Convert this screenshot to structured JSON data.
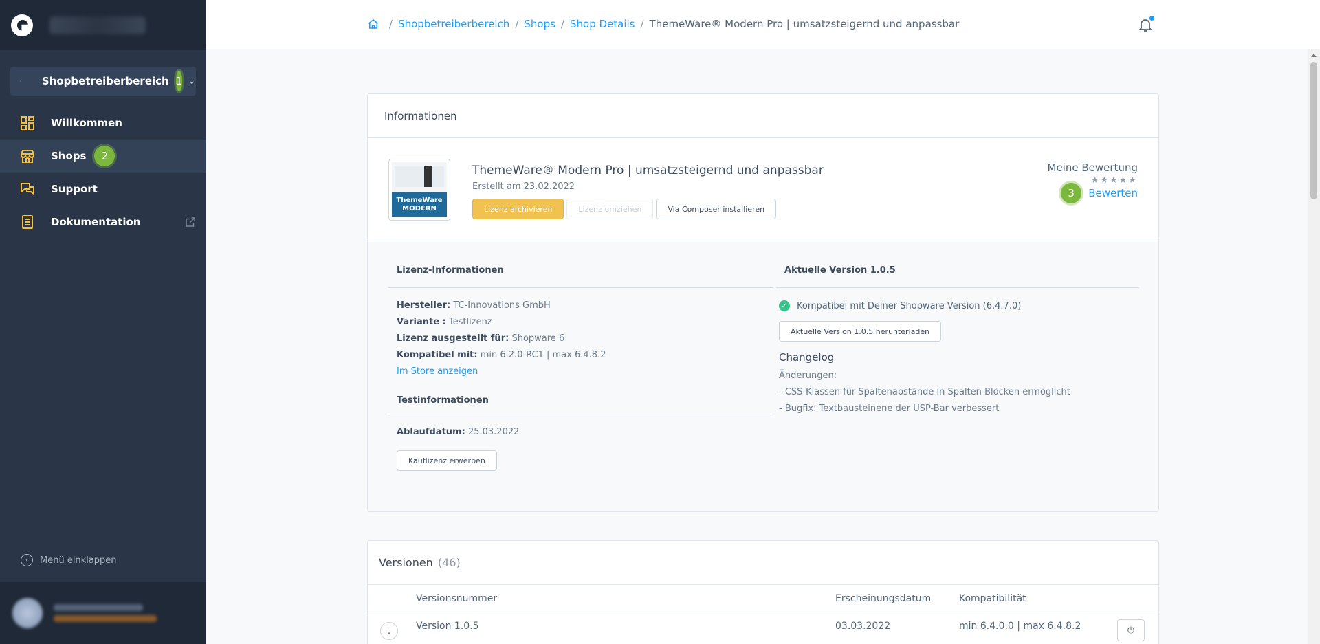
{
  "sidebar": {
    "section_label": "Shopbetreiberbereich",
    "section_badge": "1",
    "items": [
      {
        "label": "Willkommen"
      },
      {
        "label": "Shops",
        "badge": "2"
      },
      {
        "label": "Support"
      },
      {
        "label": "Dokumentation"
      }
    ],
    "collapse_label": "Menü einklappen"
  },
  "header": {
    "breadcrumb": [
      "Shopbetreiberbereich",
      "Shops",
      "Shop Details",
      "ThemeWare® Modern Pro | umsatzsteigernd und anpassbar"
    ]
  },
  "info_card": {
    "title": "Informationen",
    "product": {
      "thumbnail_text": [
        "ThemeWare",
        "MODERN"
      ],
      "name": "ThemeWare® Modern Pro | umsatzsteigernd und anpassbar",
      "created": "Erstellt am 23.02.2022",
      "buttons": {
        "archive": "Lizenz archivieren",
        "move": "Lizenz umziehen",
        "composer": "Via Composer installieren"
      }
    },
    "rating": {
      "title": "Meine Bewertung",
      "stars": "★★★★★",
      "badge": "3",
      "link": "Bewerten"
    },
    "license": {
      "title": "Lizenz-Informationen",
      "rows": [
        {
          "label": "Hersteller:",
          "value": "TC-Innovations GmbH"
        },
        {
          "label": "Variante :",
          "value": "Testlizenz"
        },
        {
          "label": "Lizenz ausgestellt für:",
          "value": "Shopware 6"
        },
        {
          "label": "Kompatibel mit:",
          "value": "min 6.2.0-RC1 | max 6.4.8.2"
        }
      ],
      "store_link": "Im Store anzeigen",
      "test_title": "Testinformationen",
      "expiry_label": "Ablaufdatum:",
      "expiry_value": "25.03.2022",
      "buy_button": "Kauflizenz erwerben"
    },
    "version": {
      "title": "Aktuelle Version 1.0.5",
      "compat_text": "Kompatibel mit Deiner Shopware Version (6.4.7.0)",
      "download_button": "Aktuelle Version 1.0.5 herunterladen",
      "changelog_title": "Changelog",
      "changelog_lines": [
        "Änderungen:",
        "- CSS-Klassen für Spaltenabstände in Spalten-Blöcken ermöglicht",
        "- Bugfix: Textbausteinene der USP-Bar verbessert"
      ]
    }
  },
  "versions_card": {
    "title": "Versionen",
    "count": "(46)",
    "columns": [
      "Versionsnummer",
      "Erscheinungsdatum",
      "Kompatibilität"
    ],
    "rows": [
      {
        "version": "Version 1.0.5",
        "date": "03.03.2022",
        "compat": "min 6.4.0.0 | max 6.4.8.2"
      }
    ]
  },
  "colors": {
    "accent": "#189eff",
    "sidebar_bg": "#2a3648",
    "highlight_badge": "#7cb83e",
    "primary_button": "#f1c24f"
  }
}
